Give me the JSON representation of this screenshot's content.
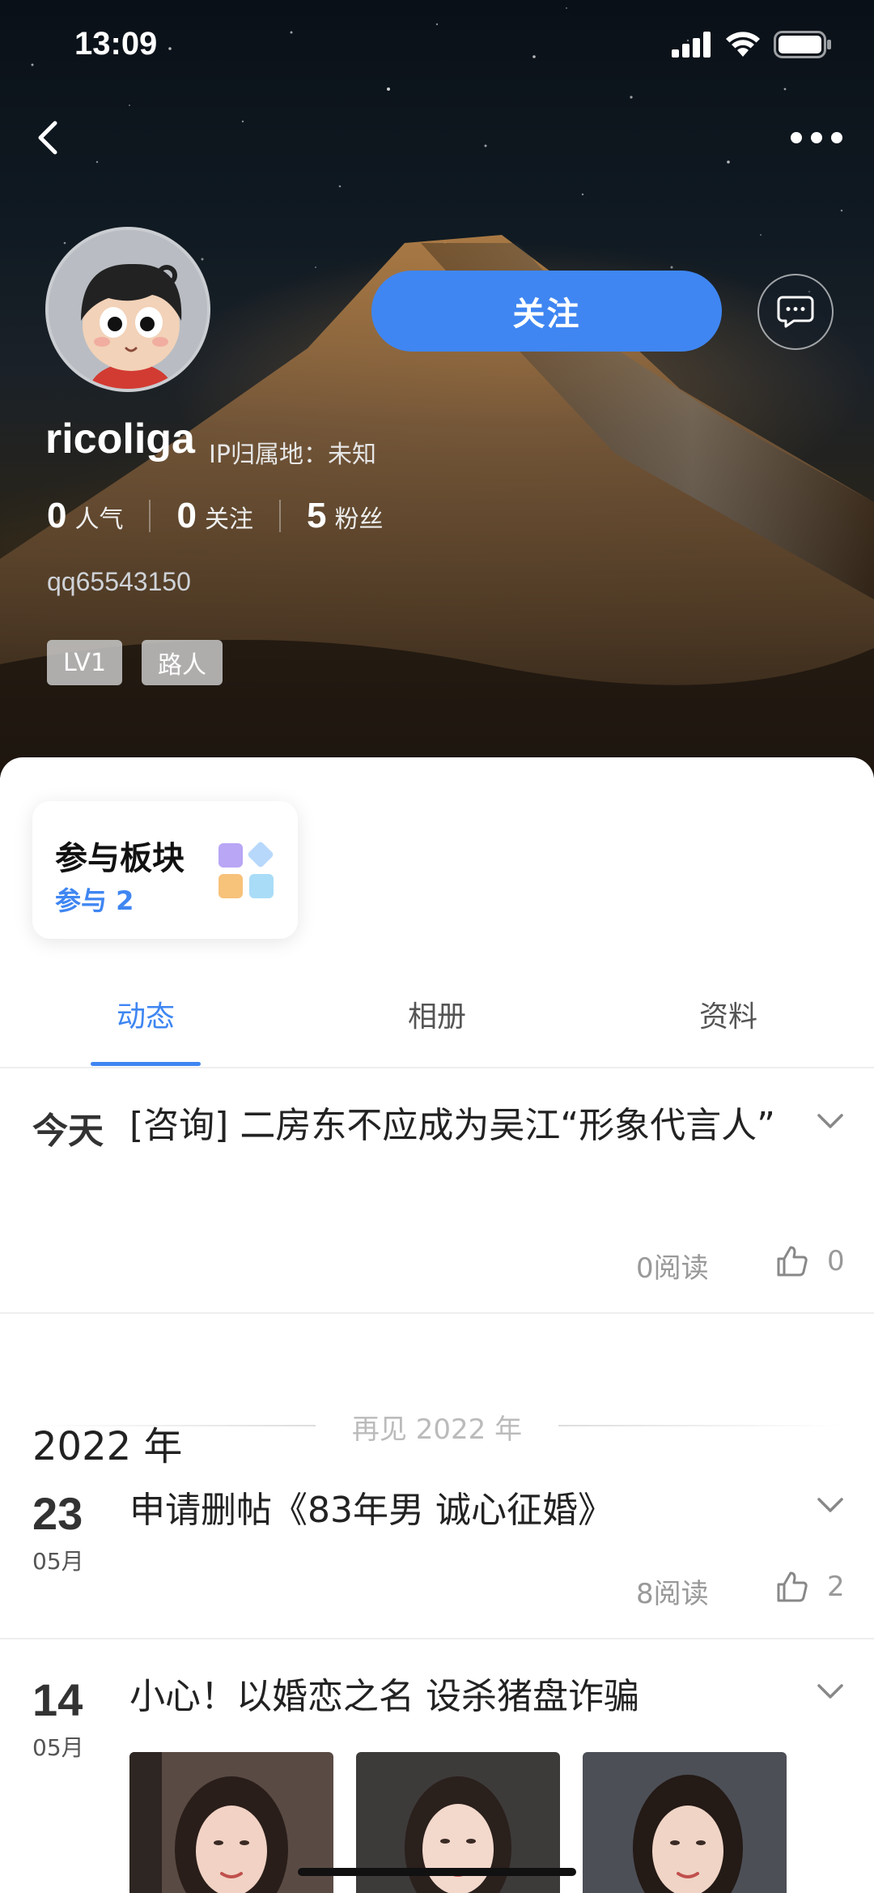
{
  "status_bar": {
    "time": "13:09"
  },
  "header": {
    "back_icon": "chevron-left-icon",
    "more_icon": "ellipsis-icon"
  },
  "profile": {
    "username": "ricoliga",
    "ip_location": "IP归属地：未知",
    "follow_label": "关注",
    "message_icon": "chat-bubble-icon",
    "user_id": "qq65543150",
    "stats": [
      {
        "value": "0",
        "label": "人气"
      },
      {
        "value": "0",
        "label": "关注"
      },
      {
        "value": "5",
        "label": "粉丝"
      }
    ],
    "badges": [
      "LV1",
      "路人"
    ]
  },
  "board_card": {
    "title": "参与板块",
    "subtitle": "参与 2"
  },
  "tabs": [
    {
      "label": "动态",
      "active": true
    },
    {
      "label": "相册",
      "active": false
    },
    {
      "label": "资料",
      "active": false
    }
  ],
  "posts": [
    {
      "date_label": "今天",
      "title": "[咨询] 二房东不应成为吴江“形象代言人”",
      "reads": "0阅读",
      "likes": "0"
    },
    {
      "day": "23",
      "month": "05月",
      "title": "申请删帖《83年男 诚心征婚》",
      "reads": "8阅读",
      "likes": "2"
    },
    {
      "day": "14",
      "month": "05月",
      "title": "小心！以婚恋之名 设杀猪盘诈骗"
    }
  ],
  "year_divider": "再见 2022 年",
  "year_heading": "2022 年",
  "colors": {
    "accent": "#3f86f2",
    "text": "#222222",
    "muted": "#999999"
  }
}
